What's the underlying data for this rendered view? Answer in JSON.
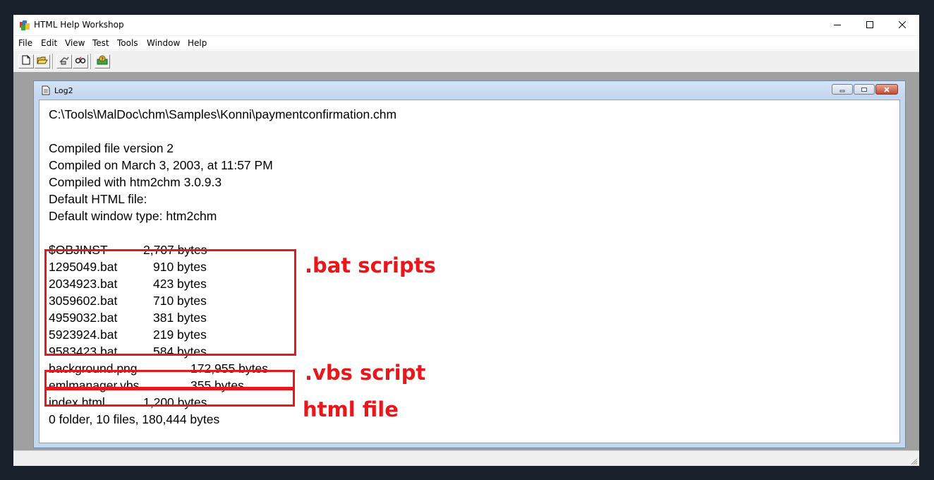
{
  "window": {
    "title": "HTML Help Workshop",
    "icon": "help-workshop-icon",
    "controls": {
      "minimize_icon": "minimize-icon",
      "maximize_icon": "maximize-icon",
      "close_icon": "close-icon"
    }
  },
  "menu": [
    "File",
    "Edit",
    "View",
    "Test",
    "Tools",
    "Window",
    "Help"
  ],
  "toolbar": {
    "buttons": [
      "new-icon",
      "open-icon",
      "compile-icon",
      "view-compiled-icon",
      "help-icon"
    ]
  },
  "log_window": {
    "title": "Log2",
    "lines": {
      "path": "C:\\Tools\\MalDoc\\chm\\Samples\\Konni\\paymentconfirmation.chm",
      "version": "Compiled file version 2",
      "compiled_on": "Compiled on March 3, 2003, at 11:57 PM",
      "compiled_with": "Compiled with htm2chm 3.0.9.3",
      "default_html": "Default HTML file:",
      "default_window": "Default window type: htm2chm",
      "summary": "0 folder, 10 files, 180,444 bytes"
    },
    "files": [
      {
        "name": "$OBJINST",
        "size": "2,707 bytes"
      },
      {
        "name": "1295049.bat",
        "size": "910 bytes"
      },
      {
        "name": "2034923.bat",
        "size": "423 bytes"
      },
      {
        "name": "3059602.bat",
        "size": "710 bytes"
      },
      {
        "name": "4959032.bat",
        "size": "381 bytes"
      },
      {
        "name": "5923924.bat",
        "size": "219 bytes"
      },
      {
        "name": "9583423.bat",
        "size": "584 bytes"
      },
      {
        "name": "background.png",
        "size": "172,955 bytes"
      },
      {
        "name": "emlmanager.vbs",
        "size": "355 bytes"
      },
      {
        "name": "index.html",
        "size": "1,200 bytes"
      }
    ]
  },
  "annotations": {
    "bat": ".bat scripts",
    "vbs": ".vbs script",
    "html": "html file",
    "color": "#e8171b"
  }
}
